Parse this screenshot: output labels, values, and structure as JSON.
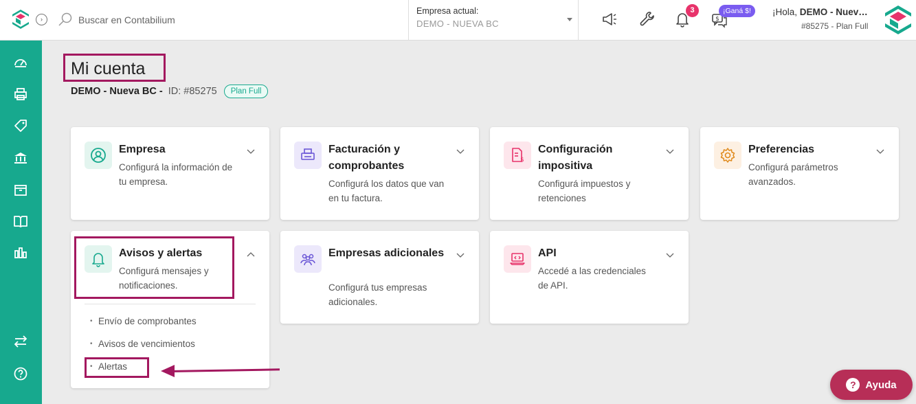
{
  "topbar": {
    "search_placeholder": "Buscar en Contabilium",
    "company_label": "Empresa actual:",
    "company_value": "DEMO - NUEVA BC",
    "notif_count": "3",
    "gana_label": "¡Ganá $!",
    "greeting_prefix": "¡Hola, ",
    "greeting_name": "DEMO - Nuev…",
    "account_id": "#85275 - Plan Full"
  },
  "header": {
    "title": "Mi cuenta",
    "company": "DEMO - Nueva BC -",
    "id": "ID: #85275",
    "plan": "Plan Full"
  },
  "cards": [
    {
      "title": "Empresa",
      "desc": "Configurá la información de tu empresa."
    },
    {
      "title": "Facturación y comprobantes",
      "desc": "Configurá los datos que van en tu factura."
    },
    {
      "title": "Configuración impositiva",
      "desc": "Configurá impuestos y retenciones"
    },
    {
      "title": "Preferencias",
      "desc": "Configurá parámetros avanzados."
    },
    {
      "title": "Avisos y alertas",
      "desc": "Configurá mensajes y notificaciones.",
      "items": [
        "Envío de comprobantes",
        "Avisos de vencimientos",
        "Alertas"
      ]
    },
    {
      "title": "Empresas adicionales",
      "desc": "Configurá tus empresas adicionales."
    },
    {
      "title": "API",
      "desc": "Accedé a las credenciales de API."
    }
  ],
  "help": {
    "label": "Ayuda"
  },
  "colors": {
    "brand": "#17a98e",
    "highlight": "#a3185f",
    "help": "#b72e57"
  }
}
